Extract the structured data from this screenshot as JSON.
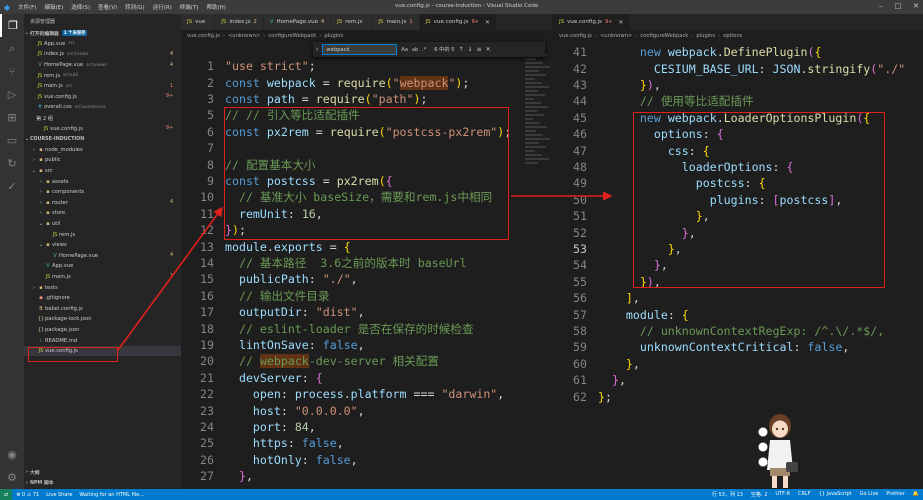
{
  "titlebar": {
    "menu": [
      "文件(F)",
      "编辑(E)",
      "选择(S)",
      "查看(V)",
      "转到(G)",
      "运行(R)",
      "终端(T)",
      "帮助(H)"
    ],
    "window_title": "vue.config.js - course-induction - Visual Studio Code"
  },
  "sidebar": {
    "header": "资源管理器",
    "open_editors_label": "打开的编辑器",
    "unsaved_tag": "1 个未保存",
    "open_editors": [
      {
        "icon": "JS",
        "name": "App.vue",
        "path": "src",
        "badge": ""
      },
      {
        "icon": "JS",
        "name": "index.js",
        "path": "src\\router",
        "badge": "4"
      },
      {
        "icon": "V",
        "name": "HomePage.vue",
        "path": "src\\views",
        "badge": "4"
      },
      {
        "icon": "JS",
        "name": "rem.js",
        "path": "src\\util",
        "badge": ""
      },
      {
        "icon": "JS",
        "name": "main.js",
        "path": "src",
        "badge": "1"
      },
      {
        "icon": "JS",
        "name": "vue.config.js",
        "path": "",
        "badge": "9+"
      },
      {
        "icon": "#",
        "name": "overall.css",
        "path": "src\\assets\\css",
        "badge": ""
      }
    ],
    "group2_label": "第 2 组",
    "group2_items": [
      {
        "icon": "JS",
        "name": "vue.config.js",
        "path": "",
        "badge": "9+"
      }
    ],
    "project_label": "COURSE-INDUCTION",
    "tree": [
      {
        "depth": 1,
        "chev": "›",
        "icon": "▪",
        "name": "node_modules",
        "badge": ""
      },
      {
        "depth": 1,
        "chev": "›",
        "icon": "▪",
        "name": "public",
        "badge": ""
      },
      {
        "depth": 1,
        "chev": "⌄",
        "icon": "▪",
        "name": "src",
        "badge": ""
      },
      {
        "depth": 2,
        "chev": "›",
        "icon": "▪",
        "name": "assets",
        "badge": ""
      },
      {
        "depth": 2,
        "chev": "›",
        "icon": "▪",
        "name": "components",
        "badge": ""
      },
      {
        "depth": 2,
        "chev": "›",
        "icon": "▪",
        "name": "router",
        "badge": "4"
      },
      {
        "depth": 2,
        "chev": "›",
        "icon": "▪",
        "name": "store",
        "badge": ""
      },
      {
        "depth": 2,
        "chev": "⌄",
        "icon": "▪",
        "name": "util",
        "badge": ""
      },
      {
        "depth": 3,
        "chev": "",
        "icon": "JS",
        "name": "rem.js",
        "badge": ""
      },
      {
        "depth": 2,
        "chev": "⌄",
        "icon": "▪",
        "name": "views",
        "badge": ""
      },
      {
        "depth": 3,
        "chev": "",
        "icon": "V",
        "name": "HomePage.vue",
        "badge": "4"
      },
      {
        "depth": 2,
        "chev": "",
        "icon": "V",
        "name": "App.vue",
        "badge": ""
      },
      {
        "depth": 2,
        "chev": "",
        "icon": "JS",
        "name": "main.js",
        "badge": "1"
      },
      {
        "depth": 1,
        "chev": "›",
        "icon": "▪",
        "name": "tests",
        "badge": ""
      },
      {
        "depth": 1,
        "chev": "",
        "icon": "◆",
        "name": ".gitignore",
        "badge": ""
      },
      {
        "depth": 1,
        "chev": "",
        "icon": "B",
        "name": "babel.config.js",
        "badge": ""
      },
      {
        "depth": 1,
        "chev": "",
        "icon": "{}",
        "name": "package-lock.json",
        "badge": ""
      },
      {
        "depth": 1,
        "chev": "",
        "icon": "{}",
        "name": "package.json",
        "badge": ""
      },
      {
        "depth": 1,
        "chev": "",
        "icon": "i",
        "name": "README.md",
        "badge": ""
      },
      {
        "depth": 1,
        "chev": "",
        "icon": "JS",
        "name": "vue.config.js",
        "badge": ""
      }
    ],
    "outline_label": "大纲",
    "npm_label": "NPM 脚本"
  },
  "left_tabs": [
    {
      "name": "vue",
      "badge": ""
    },
    {
      "name": "index.js",
      "badge": "2"
    },
    {
      "name": "HomePage.vue",
      "badge": "4"
    },
    {
      "name": "rem.js",
      "badge": ""
    },
    {
      "name": "main.js",
      "badge": "1"
    },
    {
      "name": "vue.config.js",
      "badge": "9+"
    }
  ],
  "right_tabs": [
    {
      "name": "vue.config.js",
      "badge": "9+"
    }
  ],
  "left_breadcrumb": [
    "vue.config.js",
    "<unknown>",
    "configureWebpack",
    "plugins"
  ],
  "right_breadcrumb": [
    "vue.config.js",
    "<unknown>",
    "configureWebpack",
    "plugins",
    "options"
  ],
  "find": {
    "value": "webpack",
    "options": [
      "Aa",
      "ab",
      ".*"
    ],
    "count": "6 中的 5"
  },
  "statusbar": {
    "left": [
      "⊗ 0 ⚠ 71",
      "Live Share",
      "Waiting for an HTML file..."
    ],
    "right": [
      "行 53，列 13",
      "空格: 2",
      "UTF-8",
      "CRLF",
      "{} JavaScript",
      "Go Live",
      "Prettier"
    ]
  },
  "colors": {
    "accent": "#007acc",
    "annotation": "#e0201b",
    "background": "#1e1e1e"
  }
}
